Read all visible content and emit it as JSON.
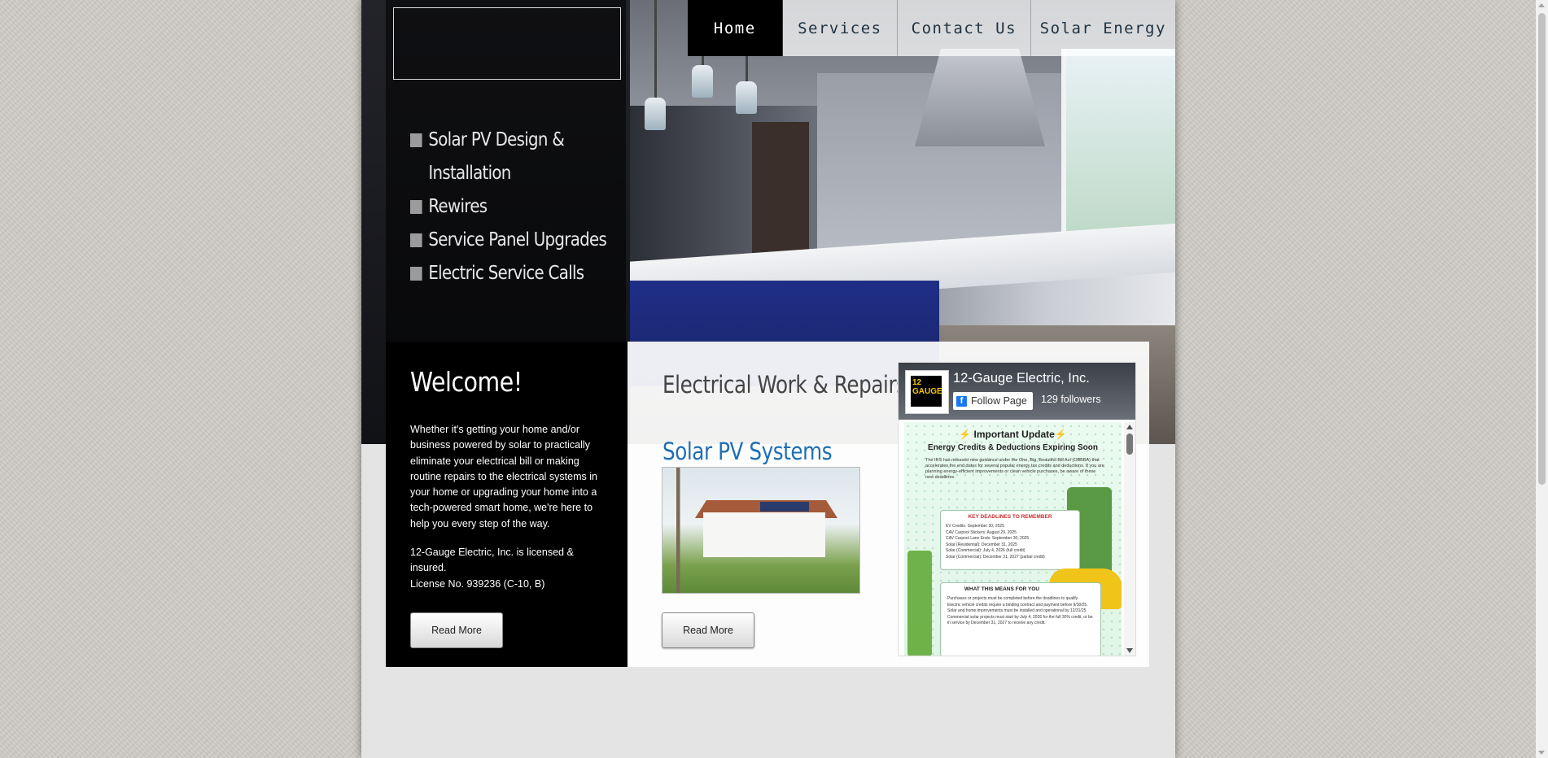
{
  "nav": {
    "items": [
      {
        "label": "Home",
        "active": true
      },
      {
        "label": "Services",
        "active": false
      },
      {
        "label": "Contact Us",
        "active": false
      },
      {
        "label": "Solar Energy",
        "active": false
      }
    ]
  },
  "services": [
    "Solar PV Design &",
    "Installation",
    "Rewires",
    "Service Panel Upgrades",
    "Electric Service Calls"
  ],
  "welcome": {
    "title": "Welcome!",
    "paragraph": "Whether it's getting your home and/or business powered by solar to practically eliminate your electrical bill or making routine repairs to the electrical systems in your home or upgrading your  home into a tech-powered smart home, we're here to help you every step of the way.",
    "license_line1": "12-Gauge Electric, Inc. is licensed & insured.",
    "license_line2": "License No. 939236 (C-10, B)",
    "read_more": "Read More"
  },
  "work": {
    "title": "Electrical Work & Repairs",
    "subtitle": "Solar PV Systems",
    "read_more": "Read More"
  },
  "facebook": {
    "page_name": "12-Gauge Electric, Inc.",
    "logo_text": "12 GAUGE",
    "follow_label": "Follow Page",
    "followers": "129 followers",
    "post": {
      "title": "⚡ Important Update⚡",
      "subtitle": "Energy Credits & Deductions Expiring Soon",
      "body": "The IRS has released new guidance under the One, Big, Beautiful Bill Act (OBBBA) that accelerates the end dates for several popular energy tax credits and deductions. If you are planning energy-efficient improvements or clean vehicle purchases, be aware of these new deadlines.",
      "deadlines_title": "KEY DEADLINES TO REMEMBER",
      "deadlines": [
        "EV Credits: September 30, 2025",
        "CAV Carpool Stickers: August 29, 2025",
        "CAV Carpool Lane Ends: September 30, 2025",
        "Solar (Residential): December 31, 2025",
        "Solar (Commercial): July 4, 2026 (full credit)",
        "Solar (Commercial): December 31, 2027 (partial credit)"
      ],
      "means_title": "WHAT THIS MEANS FOR YOU",
      "means": [
        "Purchases or projects must be completed before the deadlines to qualify.",
        "Electric vehicle credits require a binding contract and payment before 9/30/25.",
        "Solar and home improvements must be installed and operational by 12/31/25.",
        "Commercial solar projects must start by July 4, 2026 for the full 30% credit, or be in service by December 31, 2027 to receive any credit."
      ]
    }
  },
  "colors": {
    "link_blue": "#1e6fb5",
    "nav_text": "#1e3240",
    "facebook_blue": "#1877f2"
  }
}
